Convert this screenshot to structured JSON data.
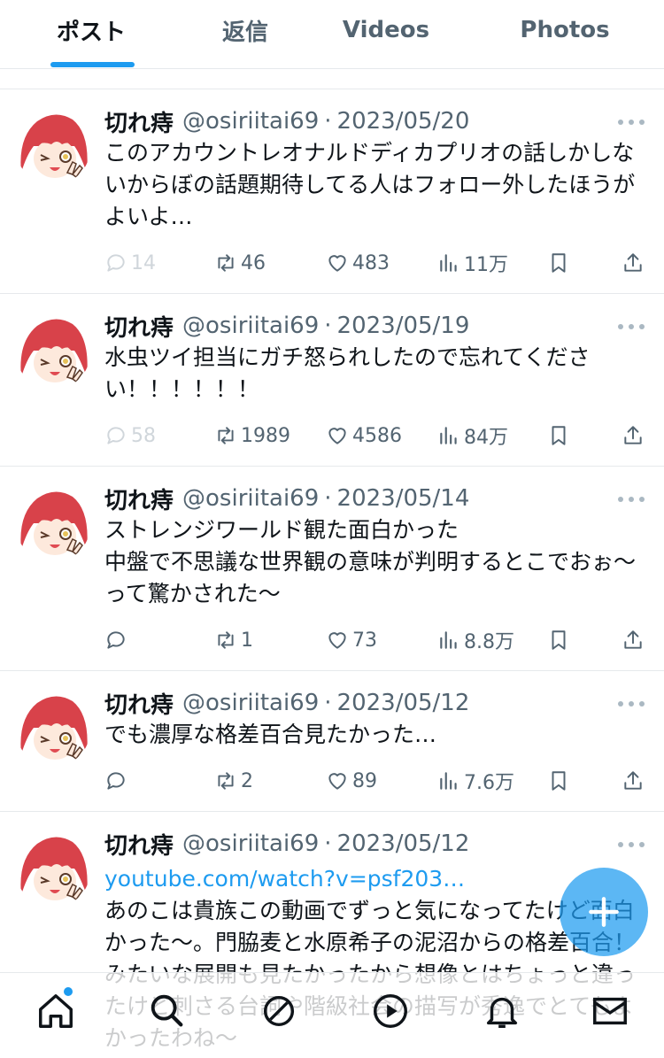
{
  "tabs": [
    {
      "label": "ポスト",
      "active": true
    },
    {
      "label": "返信",
      "active": false
    },
    {
      "label": "Videos",
      "active": false
    },
    {
      "label": "Photos",
      "active": false
    }
  ],
  "colors": {
    "accent": "#1d9bf0",
    "muted": "#536471",
    "text": "#0f1419",
    "avatar_bg": "#d8424a"
  },
  "posts": [
    {
      "name": "切れ痔",
      "handle": "@osiriitai69",
      "date": "2023/05/20",
      "text": "このアカウントレオナルドディカプリオの話しかしないからぼの話題期待してる人はフォロー外したほうがよいよ…",
      "replies": "14",
      "reposts": "46",
      "likes": "483",
      "views": "11万"
    },
    {
      "name": "切れ痔",
      "handle": "@osiriitai69",
      "date": "2023/05/19",
      "text": "水虫ツイ担当にガチ怒られしたので忘れてください！！！！！！",
      "replies": "58",
      "reposts": "1989",
      "likes": "4586",
      "views": "84万"
    },
    {
      "name": "切れ痔",
      "handle": "@osiriitai69",
      "date": "2023/05/14",
      "text": "ストレンジワールド観た面白かった\n中盤で不思議な世界観の意味が判明するとこでおぉ〜って驚かされた〜",
      "replies": "",
      "reposts": "1",
      "likes": "73",
      "views": "8.8万"
    },
    {
      "name": "切れ痔",
      "handle": "@osiriitai69",
      "date": "2023/05/12",
      "text": "でも濃厚な格差百合見たかった…",
      "replies": "",
      "reposts": "2",
      "likes": "89",
      "views": "7.6万"
    },
    {
      "name": "切れ痔",
      "handle": "@osiriitai69",
      "date": "2023/05/12",
      "link": "youtube.com/watch?v=psf203…",
      "text": "あのこは貴族この動画でずっと気になってたけど面白かった〜。門脇麦と水原希子の泥沼からの格差百合！みたいな展開も見たかったから想像とはちょっと違ったけど刺さる台詞や階級社会の描写が秀逸でとてもよかったわね〜"
    }
  ],
  "nav": {
    "icons": [
      "home-icon",
      "search-icon",
      "spaces-icon",
      "video-icon",
      "notifications-icon",
      "messages-icon"
    ]
  },
  "fab": {
    "icon": "compose-plus-icon"
  }
}
